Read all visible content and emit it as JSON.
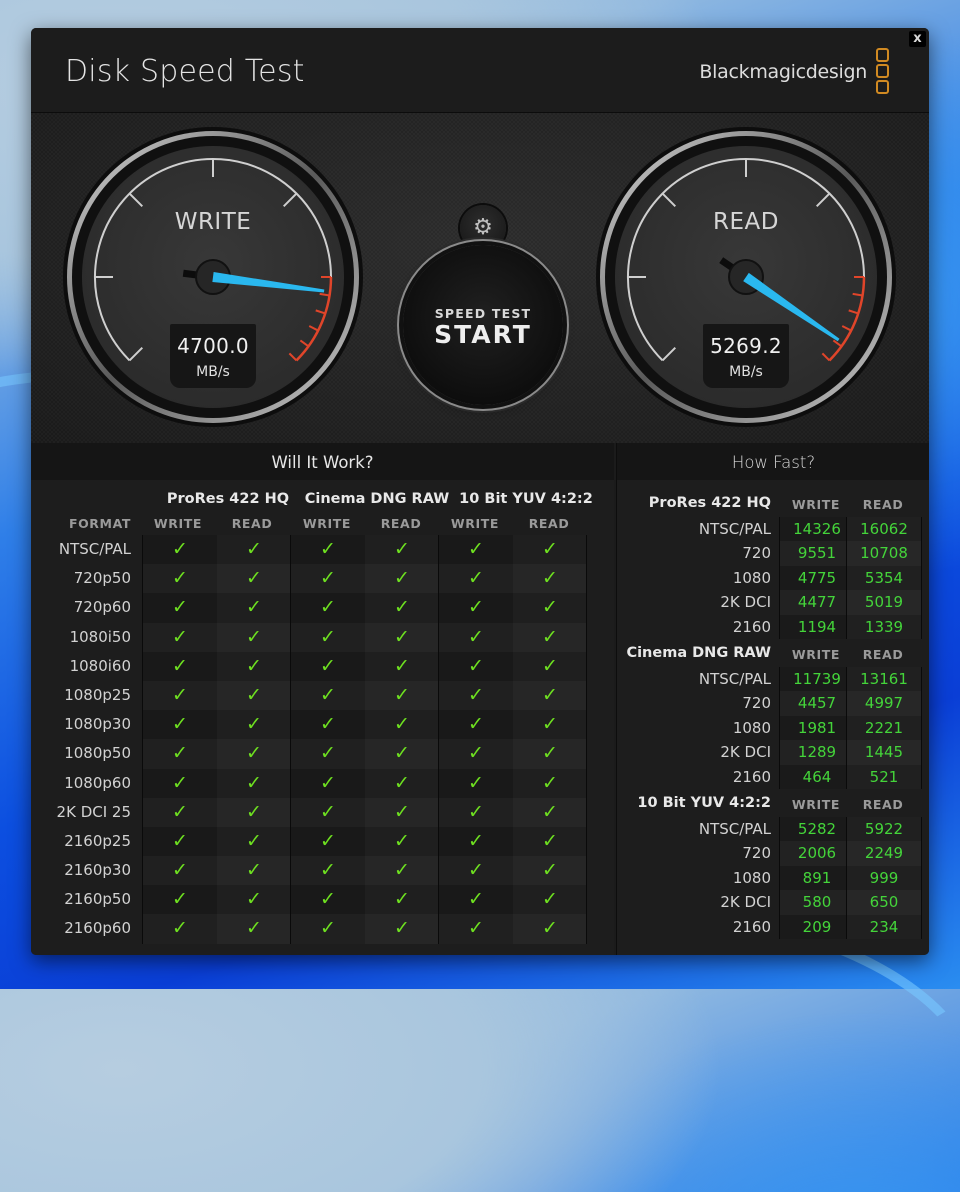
{
  "app": {
    "title": "Disk Speed Test",
    "brand": "Blackmagicdesign",
    "close_label": "x",
    "brand_color": "#d18a22"
  },
  "gauges": {
    "write": {
      "label": "WRITE",
      "value": "4700.0",
      "unit": "MB/s",
      "needle_fraction": 0.86
    },
    "read": {
      "label": "READ",
      "value": "5269.2",
      "unit": "MB/s",
      "needle_fraction": 0.96
    },
    "needle_color": "#2ab8ef",
    "redline_color": "#e0452a"
  },
  "controls": {
    "settings_icon": "gear-icon",
    "start_top": "SPEED TEST",
    "start_bottom": "START"
  },
  "will_it_work": {
    "title": "Will It Work?",
    "format_header": "FORMAT",
    "codecs": [
      "ProRes 422 HQ",
      "Cinema DNG RAW",
      "10 Bit YUV 4:2:2"
    ],
    "columns": [
      "WRITE",
      "READ",
      "WRITE",
      "READ",
      "WRITE",
      "READ"
    ],
    "check_symbol": "✓",
    "rows": [
      {
        "format": "NTSC/PAL",
        "results": [
          true,
          true,
          true,
          true,
          true,
          true
        ]
      },
      {
        "format": "720p50",
        "results": [
          true,
          true,
          true,
          true,
          true,
          true
        ]
      },
      {
        "format": "720p60",
        "results": [
          true,
          true,
          true,
          true,
          true,
          true
        ]
      },
      {
        "format": "1080i50",
        "results": [
          true,
          true,
          true,
          true,
          true,
          true
        ]
      },
      {
        "format": "1080i60",
        "results": [
          true,
          true,
          true,
          true,
          true,
          true
        ]
      },
      {
        "format": "1080p25",
        "results": [
          true,
          true,
          true,
          true,
          true,
          true
        ]
      },
      {
        "format": "1080p30",
        "results": [
          true,
          true,
          true,
          true,
          true,
          true
        ]
      },
      {
        "format": "1080p50",
        "results": [
          true,
          true,
          true,
          true,
          true,
          true
        ]
      },
      {
        "format": "1080p60",
        "results": [
          true,
          true,
          true,
          true,
          true,
          true
        ]
      },
      {
        "format": "2K DCI 25",
        "results": [
          true,
          true,
          true,
          true,
          true,
          true
        ]
      },
      {
        "format": "2160p25",
        "results": [
          true,
          true,
          true,
          true,
          true,
          true
        ]
      },
      {
        "format": "2160p30",
        "results": [
          true,
          true,
          true,
          true,
          true,
          true
        ]
      },
      {
        "format": "2160p50",
        "results": [
          true,
          true,
          true,
          true,
          true,
          true
        ]
      },
      {
        "format": "2160p60",
        "results": [
          true,
          true,
          true,
          true,
          true,
          true
        ]
      }
    ]
  },
  "how_fast": {
    "title": "How Fast?",
    "blocks": [
      {
        "codec": "ProRes 422 HQ",
        "write_label": "WRITE",
        "read_label": "READ",
        "rows": [
          {
            "format": "NTSC/PAL",
            "write": "14326",
            "read": "16062"
          },
          {
            "format": "720",
            "write": "9551",
            "read": "10708"
          },
          {
            "format": "1080",
            "write": "4775",
            "read": "5354"
          },
          {
            "format": "2K DCI",
            "write": "4477",
            "read": "5019"
          },
          {
            "format": "2160",
            "write": "1194",
            "read": "1339"
          }
        ]
      },
      {
        "codec": "Cinema DNG RAW",
        "write_label": "WRITE",
        "read_label": "READ",
        "rows": [
          {
            "format": "NTSC/PAL",
            "write": "11739",
            "read": "13161"
          },
          {
            "format": "720",
            "write": "4457",
            "read": "4997"
          },
          {
            "format": "1080",
            "write": "1981",
            "read": "2221"
          },
          {
            "format": "2K DCI",
            "write": "1289",
            "read": "1445"
          },
          {
            "format": "2160",
            "write": "464",
            "read": "521"
          }
        ]
      },
      {
        "codec": "10 Bit YUV 4:2:2",
        "write_label": "WRITE",
        "read_label": "READ",
        "rows": [
          {
            "format": "NTSC/PAL",
            "write": "5282",
            "read": "5922"
          },
          {
            "format": "720",
            "write": "2006",
            "read": "2249"
          },
          {
            "format": "1080",
            "write": "891",
            "read": "999"
          },
          {
            "format": "2K DCI",
            "write": "580",
            "read": "650"
          },
          {
            "format": "2160",
            "write": "209",
            "read": "234"
          }
        ]
      }
    ]
  }
}
